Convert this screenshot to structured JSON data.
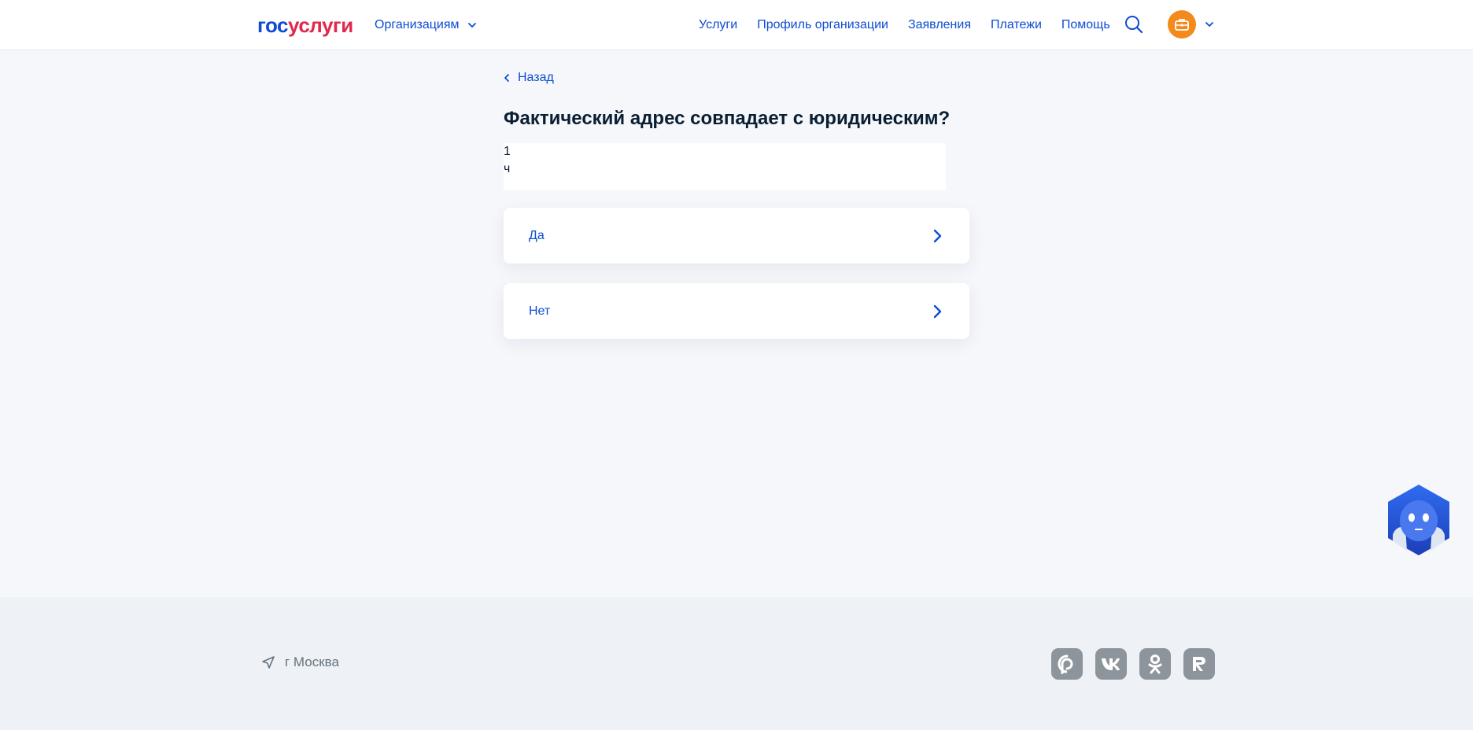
{
  "header": {
    "logo_part1": "гос",
    "logo_part2": "услуги",
    "audience_menu": "Организациям",
    "nav": [
      "Услуги",
      "Профиль организации",
      "Заявления",
      "Платежи",
      "Помощь"
    ]
  },
  "main": {
    "back_label": "Назад",
    "title": "Фактический адрес совпадает с юридическим?",
    "hint_line1": "1",
    "hint_line2": "ч",
    "options": [
      {
        "label": "Да"
      },
      {
        "label": "Нет"
      }
    ]
  },
  "footer": {
    "city": "г Москва",
    "socials": [
      "max-icon",
      "vk-icon",
      "ok-icon",
      "rutube-icon"
    ]
  },
  "colors": {
    "accent": "#0d4cd3",
    "brand_red": "#e3274b",
    "page_bg": "#f5f7fb",
    "footer_bg": "#eef2f6",
    "avatar": "#f48a1c"
  },
  "icons": {
    "search": "search-icon",
    "avatar": "briefcase-icon",
    "back": "chevron-left-icon",
    "option_arrow": "chevron-right-icon",
    "assistant": "robot-assistant-icon",
    "city": "location-arrow-icon"
  }
}
